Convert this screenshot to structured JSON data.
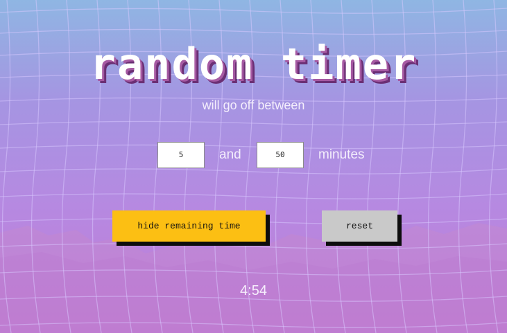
{
  "title": "random timer",
  "subtitle": "will go off between",
  "range": {
    "min_value": "5",
    "max_value": "50",
    "and_label": "and",
    "unit_label": "minutes"
  },
  "buttons": {
    "hide_label": "hide remaining time",
    "reset_label": "reset"
  },
  "remaining_time": "4:54",
  "colors": {
    "primary_button": "#fcbf13",
    "secondary_button": "#c9c9c9",
    "title_shadow": "#6b2f74"
  }
}
